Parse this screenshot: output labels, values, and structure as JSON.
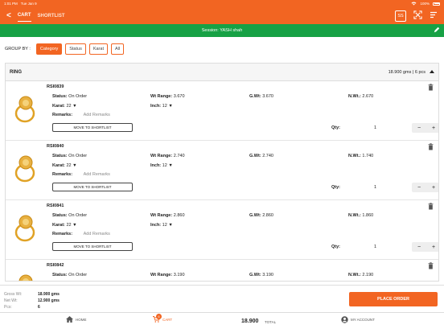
{
  "status_bar": {
    "time": "1:01 PM",
    "date": "Tue Jan 9",
    "battery": "100%"
  },
  "topbar": {
    "back": "<",
    "tabs": [
      {
        "label": "CART"
      },
      {
        "label": "SHORTLIST"
      }
    ],
    "ss_label": "SS"
  },
  "session": {
    "text": "Session: YASH shah"
  },
  "groupby": {
    "label": "GROUP BY :",
    "chips": [
      {
        "label": "Category"
      },
      {
        "label": "Status"
      },
      {
        "label": "Karat"
      },
      {
        "label": "All"
      }
    ]
  },
  "group": {
    "name": "RING",
    "summary": "18.900 gms | 6 pcs"
  },
  "labels": {
    "status": "Status:",
    "karat": "Karat:",
    "remarks": "Remarks:",
    "add_remarks": "Add Remarks",
    "wt_range": "Wt Range:",
    "inch": "Inch:",
    "gwt": "G.Wt:",
    "nwt": "N.Wt.:",
    "move": "MOVE TO SHORTLIST",
    "qty": "Qty:",
    "minus": "−",
    "plus": "+"
  },
  "items": [
    {
      "code": "RSI0839",
      "status": "On Order",
      "karat": "22",
      "wt_range": "3.670",
      "inch": "12",
      "gwt": "3.670",
      "nwt": "2.670",
      "qty": "1"
    },
    {
      "code": "RSI0840",
      "status": "On Order",
      "karat": "22",
      "wt_range": "2.740",
      "inch": "12",
      "gwt": "2.740",
      "nwt": "1.740",
      "qty": "1"
    },
    {
      "code": "RSI0841",
      "status": "On Order",
      "karat": "22",
      "wt_range": "2.860",
      "inch": "12",
      "gwt": "2.860",
      "nwt": "1.860",
      "qty": "1"
    },
    {
      "code": "RSI0842",
      "status": "On Order",
      "karat": "22",
      "wt_range": "3.190",
      "inch": "12",
      "gwt": "3.190",
      "nwt": "2.190",
      "qty": "1"
    }
  ],
  "footer": {
    "gross_label": "Gross Wt:",
    "gross": "18.900 gms",
    "net_label": "Net Wt:",
    "net": "12.900 gms",
    "pcs_label": "Pcs:",
    "pcs": "6",
    "place_order": "PLACE ORDER"
  },
  "bottom_nav": {
    "home": "HOME",
    "cart": "CART",
    "cart_badge": "6",
    "total_value": "18.900",
    "total_label": "TOTAL",
    "account": "MY ACCOUNT"
  },
  "colors": {
    "primary": "#f26522",
    "session": "#17a145"
  }
}
